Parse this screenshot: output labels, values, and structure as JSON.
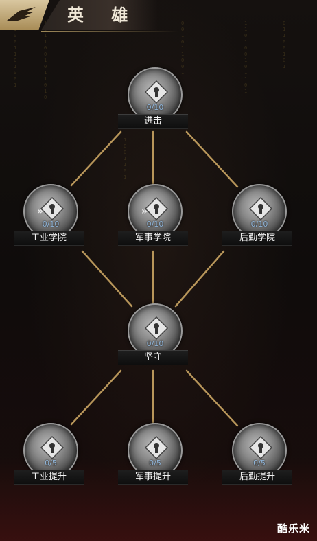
{
  "header": {
    "title": "英 雄"
  },
  "nodes": {
    "advance": {
      "name": "进击",
      "level": "0/10",
      "icon": "lock-icon"
    },
    "industry_academy": {
      "name": "工业学院",
      "level": "0/10",
      "icon": "lock-icon"
    },
    "military_academy": {
      "name": "军事学院",
      "level": "0/10",
      "icon": "lock-icon"
    },
    "logistics_academy": {
      "name": "后勤学院",
      "level": "0/10",
      "icon": "lock-icon"
    },
    "hold": {
      "name": "坚守",
      "level": "0/10",
      "icon": "lock-icon"
    },
    "industry_boost": {
      "name": "工业提升",
      "level": "0/5",
      "icon": "lock-icon"
    },
    "military_boost": {
      "name": "军事提升",
      "level": "0/5",
      "icon": "lock-icon"
    },
    "logistics_boost": {
      "name": "后勤提升",
      "level": "0/5",
      "icon": "lock-icon"
    }
  },
  "watermark": "酷乐米",
  "colors": {
    "accent_gold": "#b8965a",
    "level_text": "#8fb4d8"
  }
}
